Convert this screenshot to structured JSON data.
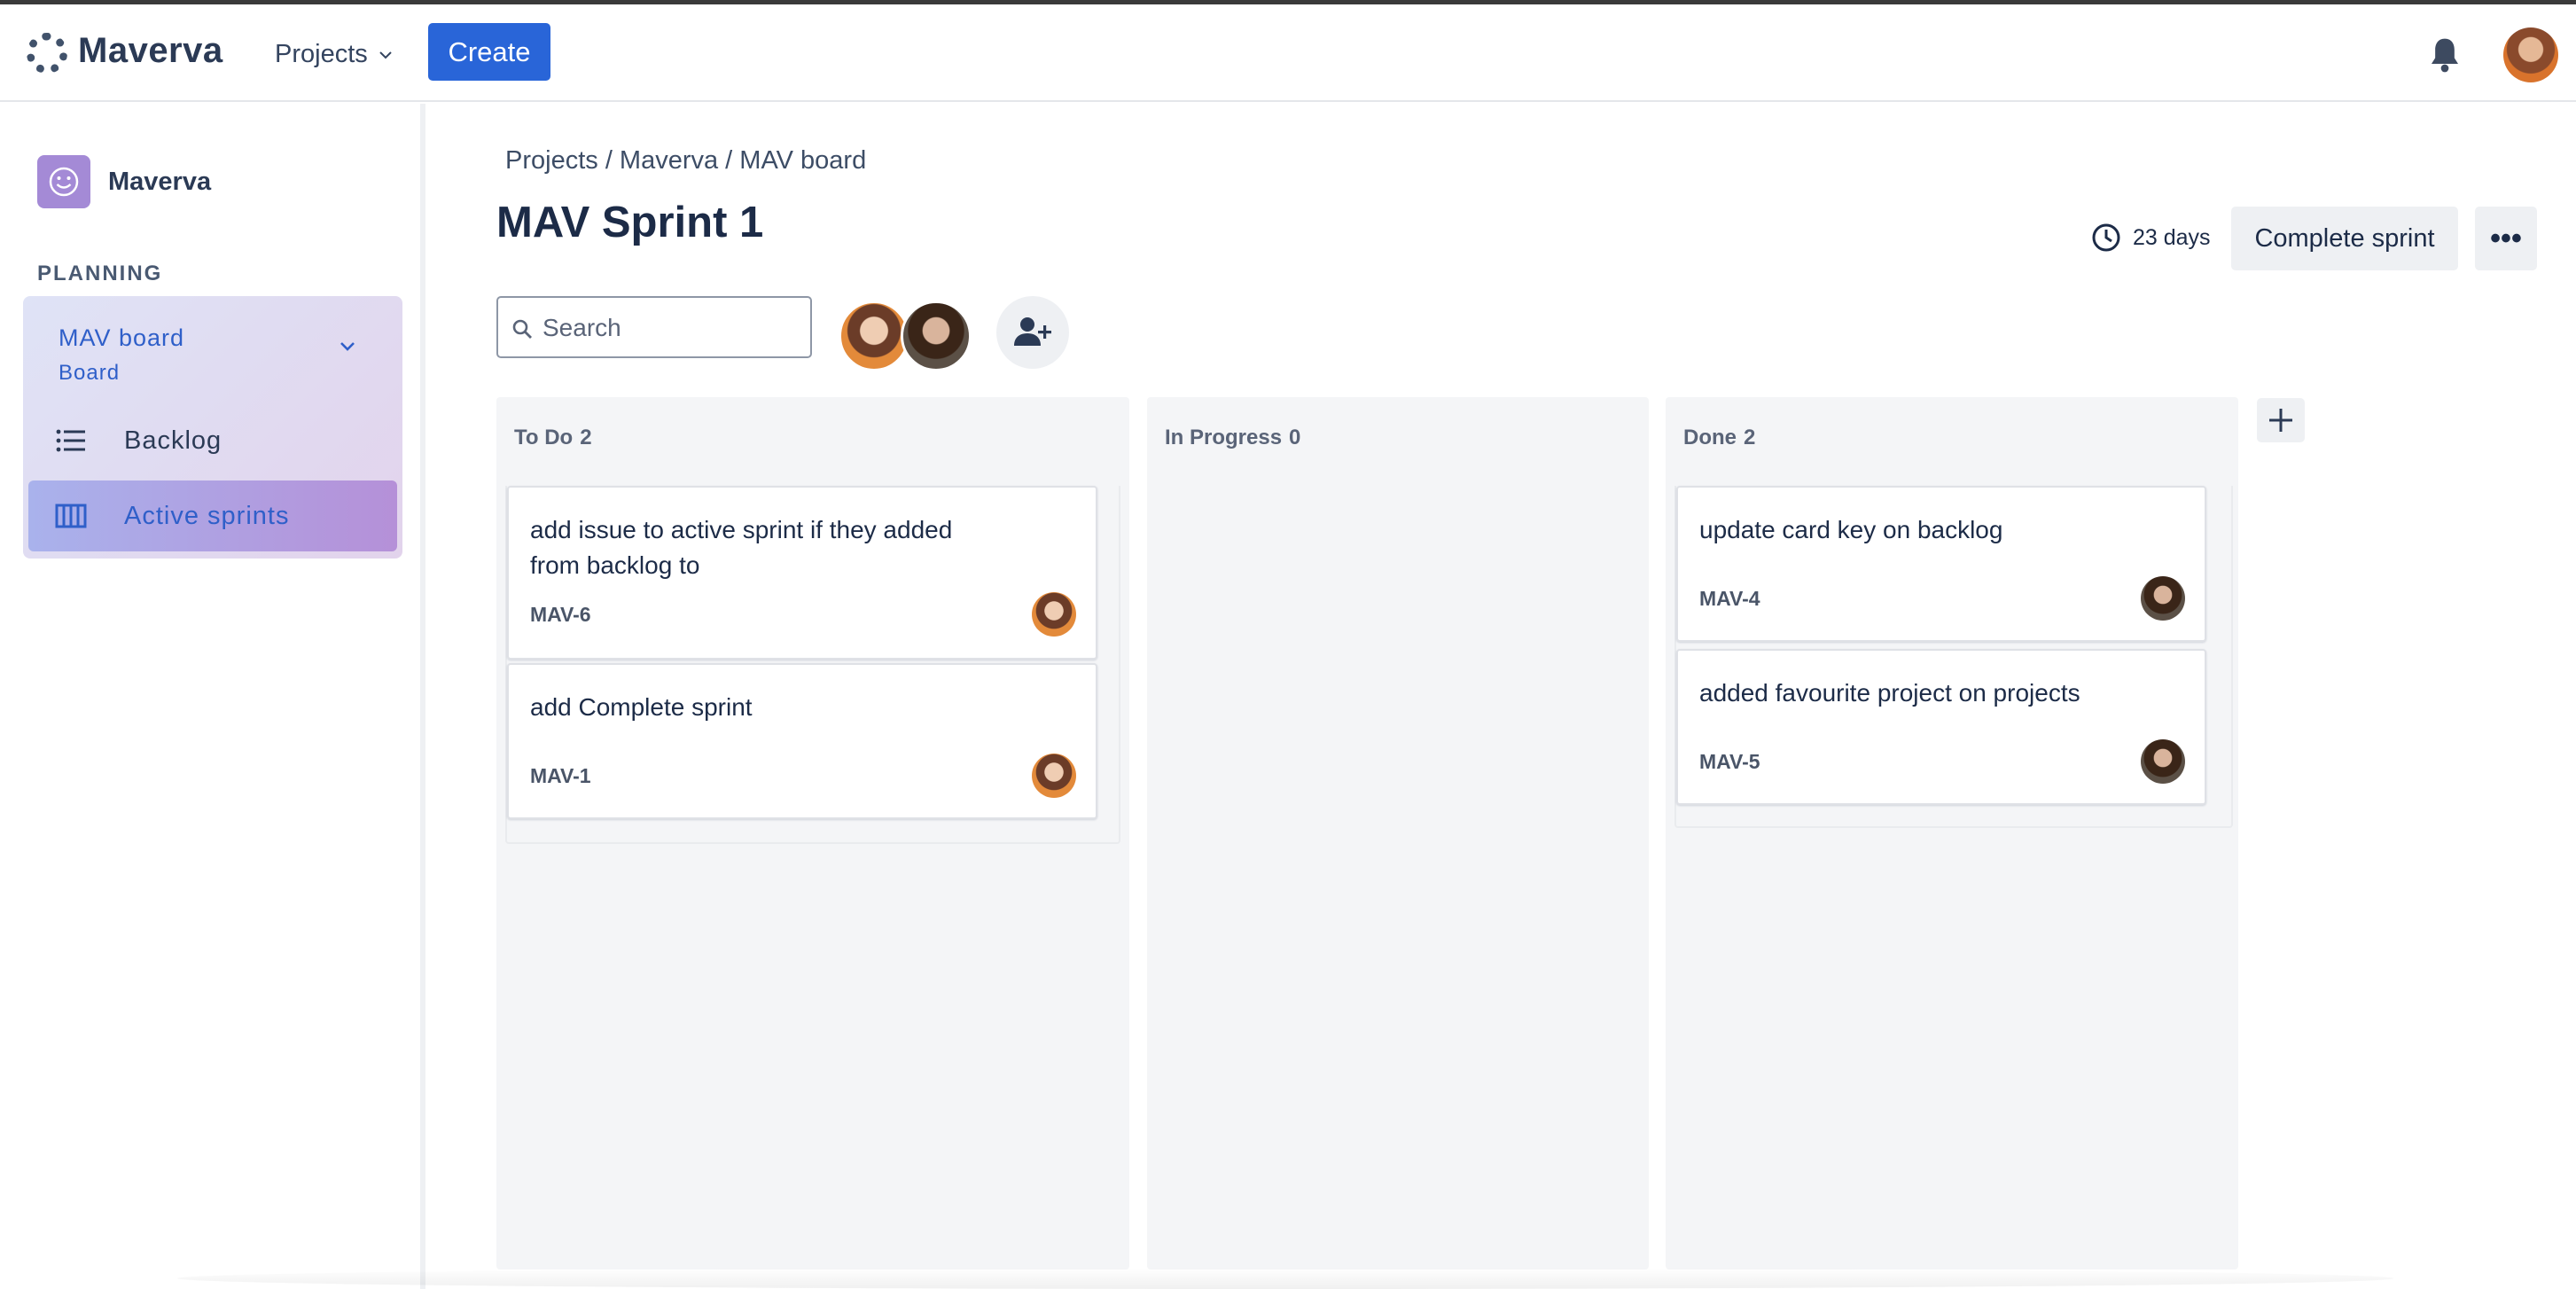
{
  "topbar": {
    "brand": "Maverva",
    "projects_label": "Projects",
    "create_label": "Create"
  },
  "sidebar": {
    "project_name": "Maverva",
    "section_label": "PLANNING",
    "board": {
      "title": "MAV board",
      "subtitle": "Board"
    },
    "items": [
      {
        "label": "Backlog",
        "icon": "list-icon"
      },
      {
        "label": "Active sprints",
        "icon": "board-columns-icon",
        "active": true
      }
    ]
  },
  "main": {
    "breadcrumb": "Projects / Maverva / MAV board",
    "title": "MAV Sprint 1",
    "days_remaining": "23 days",
    "complete_label": "Complete sprint",
    "more_label": "•••",
    "search_placeholder": "Search"
  },
  "columns": [
    {
      "title": "To Do",
      "count": "2",
      "cards": [
        {
          "title": "add issue to active sprint if they added from backlog to",
          "key": "MAV-6",
          "assignee": "orange"
        },
        {
          "title": "add Complete sprint",
          "key": "MAV-1",
          "assignee": "orange"
        }
      ]
    },
    {
      "title": "In Progress",
      "count": "0",
      "cards": []
    },
    {
      "title": "Done",
      "count": "2",
      "cards": [
        {
          "title": "update card key on backlog",
          "key": "MAV-4",
          "assignee": "dark"
        },
        {
          "title": "added favourite project on projects",
          "key": "MAV-5",
          "assignee": "dark"
        }
      ]
    }
  ],
  "colors": {
    "accent": "#2965d8",
    "text": "#172b4d",
    "column_bg": "#f4f5f7",
    "sidebar_active_from": "#a9b2ec",
    "sidebar_active_to": "#b590d8"
  }
}
